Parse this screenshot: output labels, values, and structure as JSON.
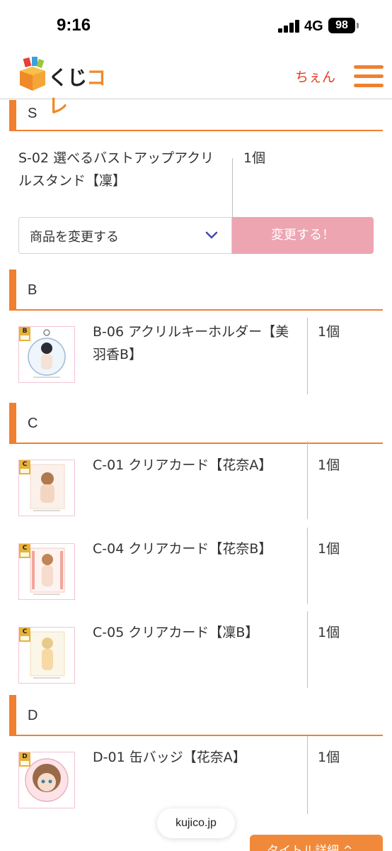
{
  "status_bar": {
    "time": "9:16",
    "network": "4G",
    "battery": "98"
  },
  "header": {
    "logo_text_main": "くじ",
    "logo_text_accent": "コレ",
    "username": "ちぇん"
  },
  "sections": {
    "s": {
      "label": "S",
      "items": [
        {
          "name": "S-02 選べるバストアップアクリルスタンド【凜】",
          "qty": "1個"
        }
      ]
    },
    "b": {
      "label": "B",
      "items": [
        {
          "name": "B-06 アクリルキーホルダー【美羽香B】",
          "qty": "1個",
          "badge": "B賞"
        }
      ]
    },
    "c": {
      "label": "C",
      "items": [
        {
          "name": "C-01 クリアカード【花奈A】",
          "qty": "1個",
          "badge": "C賞"
        },
        {
          "name": "C-04 クリアカード【花奈B】",
          "qty": "1個",
          "badge": "C賞"
        },
        {
          "name": "C-05 クリアカード【凜B】",
          "qty": "1個",
          "badge": "C賞"
        }
      ]
    },
    "d": {
      "label": "D",
      "items": [
        {
          "name": "D-01 缶バッジ【花奈A】",
          "qty": "1個",
          "badge": "D賞"
        }
      ]
    }
  },
  "change_control": {
    "selected": "商品を変更する",
    "button_label": "変更する！"
  },
  "browser": {
    "url": "kujico.jp"
  },
  "detail_button_label": "タイトル詳細",
  "colors": {
    "accent": "#f08030",
    "user": "#e53a1e",
    "change_button": "#eda5b1"
  }
}
